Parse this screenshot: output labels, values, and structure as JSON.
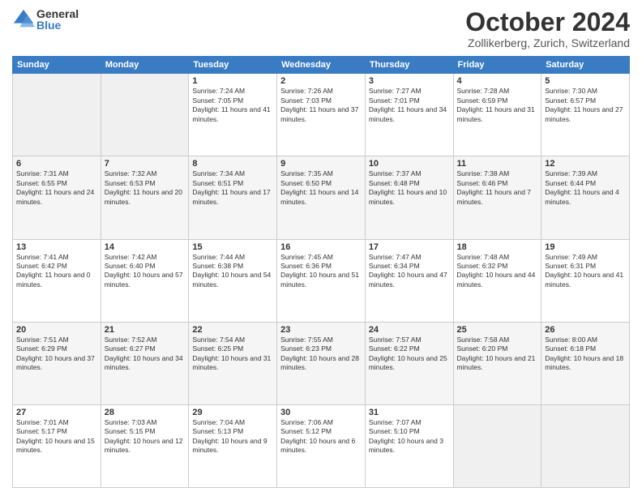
{
  "header": {
    "logo_general": "General",
    "logo_blue": "Blue",
    "month": "October 2024",
    "location": "Zollikerberg, Zurich, Switzerland"
  },
  "days_of_week": [
    "Sunday",
    "Monday",
    "Tuesday",
    "Wednesday",
    "Thursday",
    "Friday",
    "Saturday"
  ],
  "weeks": [
    [
      {
        "num": "",
        "info": ""
      },
      {
        "num": "",
        "info": ""
      },
      {
        "num": "1",
        "info": "Sunrise: 7:24 AM\nSunset: 7:05 PM\nDaylight: 11 hours and 41 minutes."
      },
      {
        "num": "2",
        "info": "Sunrise: 7:26 AM\nSunset: 7:03 PM\nDaylight: 11 hours and 37 minutes."
      },
      {
        "num": "3",
        "info": "Sunrise: 7:27 AM\nSunset: 7:01 PM\nDaylight: 11 hours and 34 minutes."
      },
      {
        "num": "4",
        "info": "Sunrise: 7:28 AM\nSunset: 6:59 PM\nDaylight: 11 hours and 31 minutes."
      },
      {
        "num": "5",
        "info": "Sunrise: 7:30 AM\nSunset: 6:57 PM\nDaylight: 11 hours and 27 minutes."
      }
    ],
    [
      {
        "num": "6",
        "info": "Sunrise: 7:31 AM\nSunset: 6:55 PM\nDaylight: 11 hours and 24 minutes."
      },
      {
        "num": "7",
        "info": "Sunrise: 7:32 AM\nSunset: 6:53 PM\nDaylight: 11 hours and 20 minutes."
      },
      {
        "num": "8",
        "info": "Sunrise: 7:34 AM\nSunset: 6:51 PM\nDaylight: 11 hours and 17 minutes."
      },
      {
        "num": "9",
        "info": "Sunrise: 7:35 AM\nSunset: 6:50 PM\nDaylight: 11 hours and 14 minutes."
      },
      {
        "num": "10",
        "info": "Sunrise: 7:37 AM\nSunset: 6:48 PM\nDaylight: 11 hours and 10 minutes."
      },
      {
        "num": "11",
        "info": "Sunrise: 7:38 AM\nSunset: 6:46 PM\nDaylight: 11 hours and 7 minutes."
      },
      {
        "num": "12",
        "info": "Sunrise: 7:39 AM\nSunset: 6:44 PM\nDaylight: 11 hours and 4 minutes."
      }
    ],
    [
      {
        "num": "13",
        "info": "Sunrise: 7:41 AM\nSunset: 6:42 PM\nDaylight: 11 hours and 0 minutes."
      },
      {
        "num": "14",
        "info": "Sunrise: 7:42 AM\nSunset: 6:40 PM\nDaylight: 10 hours and 57 minutes."
      },
      {
        "num": "15",
        "info": "Sunrise: 7:44 AM\nSunset: 6:38 PM\nDaylight: 10 hours and 54 minutes."
      },
      {
        "num": "16",
        "info": "Sunrise: 7:45 AM\nSunset: 6:36 PM\nDaylight: 10 hours and 51 minutes."
      },
      {
        "num": "17",
        "info": "Sunrise: 7:47 AM\nSunset: 6:34 PM\nDaylight: 10 hours and 47 minutes."
      },
      {
        "num": "18",
        "info": "Sunrise: 7:48 AM\nSunset: 6:32 PM\nDaylight: 10 hours and 44 minutes."
      },
      {
        "num": "19",
        "info": "Sunrise: 7:49 AM\nSunset: 6:31 PM\nDaylight: 10 hours and 41 minutes."
      }
    ],
    [
      {
        "num": "20",
        "info": "Sunrise: 7:51 AM\nSunset: 6:29 PM\nDaylight: 10 hours and 37 minutes."
      },
      {
        "num": "21",
        "info": "Sunrise: 7:52 AM\nSunset: 6:27 PM\nDaylight: 10 hours and 34 minutes."
      },
      {
        "num": "22",
        "info": "Sunrise: 7:54 AM\nSunset: 6:25 PM\nDaylight: 10 hours and 31 minutes."
      },
      {
        "num": "23",
        "info": "Sunrise: 7:55 AM\nSunset: 6:23 PM\nDaylight: 10 hours and 28 minutes."
      },
      {
        "num": "24",
        "info": "Sunrise: 7:57 AM\nSunset: 6:22 PM\nDaylight: 10 hours and 25 minutes."
      },
      {
        "num": "25",
        "info": "Sunrise: 7:58 AM\nSunset: 6:20 PM\nDaylight: 10 hours and 21 minutes."
      },
      {
        "num": "26",
        "info": "Sunrise: 8:00 AM\nSunset: 6:18 PM\nDaylight: 10 hours and 18 minutes."
      }
    ],
    [
      {
        "num": "27",
        "info": "Sunrise: 7:01 AM\nSunset: 5:17 PM\nDaylight: 10 hours and 15 minutes."
      },
      {
        "num": "28",
        "info": "Sunrise: 7:03 AM\nSunset: 5:15 PM\nDaylight: 10 hours and 12 minutes."
      },
      {
        "num": "29",
        "info": "Sunrise: 7:04 AM\nSunset: 5:13 PM\nDaylight: 10 hours and 9 minutes."
      },
      {
        "num": "30",
        "info": "Sunrise: 7:06 AM\nSunset: 5:12 PM\nDaylight: 10 hours and 6 minutes."
      },
      {
        "num": "31",
        "info": "Sunrise: 7:07 AM\nSunset: 5:10 PM\nDaylight: 10 hours and 3 minutes."
      },
      {
        "num": "",
        "info": ""
      },
      {
        "num": "",
        "info": ""
      }
    ]
  ]
}
